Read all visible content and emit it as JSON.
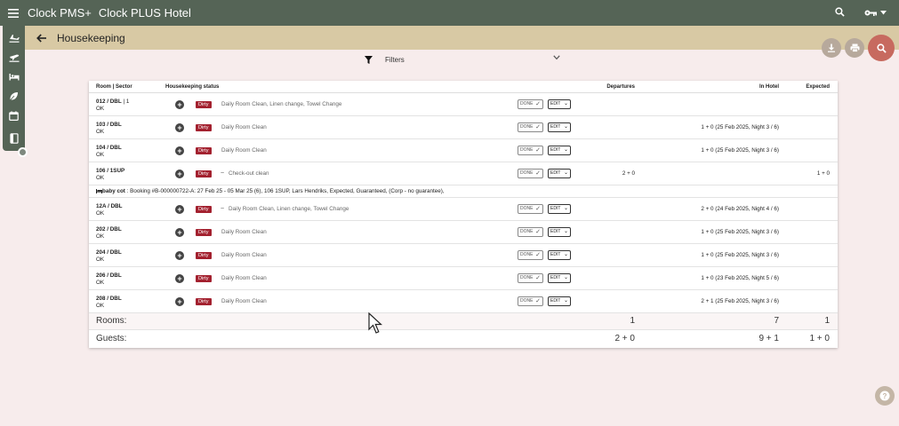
{
  "app": {
    "name": "Clock PMS+",
    "hotel": "Clock PLUS Hotel"
  },
  "page": {
    "title": "Housekeeping"
  },
  "filters": {
    "label": "Filters"
  },
  "table": {
    "headers": {
      "room": "Room | Sector",
      "hk_status": "Housekeeping status",
      "departures": "Departures",
      "in_hotel": "In Hotel",
      "expected": "Expected"
    },
    "done_label": "DONE",
    "edit_label": "EDIT",
    "rows": [
      {
        "room": "012 / DBL",
        "sector_suffix": " | 1",
        "status": "OK",
        "badge": "Dirty",
        "tilde": "",
        "tasks": "Daily Room Clean, Linen change, Towel Change",
        "departures": "",
        "in_hotel": "",
        "expected": ""
      },
      {
        "room": "103 / DBL",
        "sector_suffix": "",
        "status": "OK",
        "badge": "Dirty",
        "tilde": "",
        "tasks": "Daily Room Clean",
        "departures": "",
        "in_hotel": "1 + 0 (25 Feb 2025, Night 3 / 6)",
        "expected": ""
      },
      {
        "room": "104 / DBL",
        "sector_suffix": "",
        "status": "OK",
        "badge": "Dirty",
        "tilde": "",
        "tasks": "Daily Room Clean",
        "departures": "",
        "in_hotel": "1 + 0 (25 Feb 2025, Night 3 / 6)",
        "expected": ""
      },
      {
        "room": "106 / 1SUP",
        "sector_suffix": "",
        "status": "OK",
        "badge": "Dirty",
        "tilde": "~",
        "tasks": "Check-out clean",
        "departures": "2 + 0",
        "in_hotel": "",
        "expected": "1 + 0"
      },
      {
        "room": "12A / DBL",
        "sector_suffix": "",
        "status": "OK",
        "badge": "Dirty",
        "tilde": "~",
        "tasks": "Daily Room Clean, Linen change, Towel Change",
        "departures": "",
        "in_hotel": "2 + 0 (24 Feb 2025, Night 4 / 6)",
        "expected": ""
      },
      {
        "room": "202 / DBL",
        "sector_suffix": "",
        "status": "OK",
        "badge": "Dirty",
        "tilde": "",
        "tasks": "Daily Room Clean",
        "departures": "",
        "in_hotel": "1 + 0 (25 Feb 2025, Night 3 / 6)",
        "expected": ""
      },
      {
        "room": "204 / DBL",
        "sector_suffix": "",
        "status": "OK",
        "badge": "Dirty",
        "tilde": "",
        "tasks": "Daily Room Clean",
        "departures": "",
        "in_hotel": "1 + 0 (25 Feb 2025, Night 3 / 6)",
        "expected": ""
      },
      {
        "room": "206 / DBL",
        "sector_suffix": "",
        "status": "OK",
        "badge": "Dirty",
        "tilde": "",
        "tasks": "Daily Room Clean",
        "departures": "",
        "in_hotel": "1 + 0 (23 Feb 2025, Night 5 / 6)",
        "expected": ""
      },
      {
        "room": "208 / DBL",
        "sector_suffix": "",
        "status": "OK",
        "badge": "Dirty",
        "tilde": "",
        "tasks": "Daily Room Clean",
        "departures": "",
        "in_hotel": "2 + 1 (25 Feb 2025, Night 3 / 6)",
        "expected": ""
      }
    ],
    "note": {
      "title": "baby cot",
      "text": " : Booking #B-000000722-A: 27 Feb 25 - 05 Mar 25 (6), 106 1SUP, Lars Hendriks, Expected, Guaranteed, (Corp - no guarantee),"
    },
    "totals": {
      "rooms_label": "Rooms:",
      "rooms_departures": "1",
      "rooms_in_hotel": "7",
      "rooms_expected": "1",
      "guests_label": "Guests:",
      "guests_departures": "2 + 0",
      "guests_in_hotel": "9 + 1",
      "guests_expected": "1 + 0"
    }
  },
  "colors": {
    "topbar": "#556456",
    "titlebar": "#d8c9a4",
    "dirty_badge": "#a3212f",
    "search_fab": "#c76a5f",
    "background": "#f7ecec"
  }
}
